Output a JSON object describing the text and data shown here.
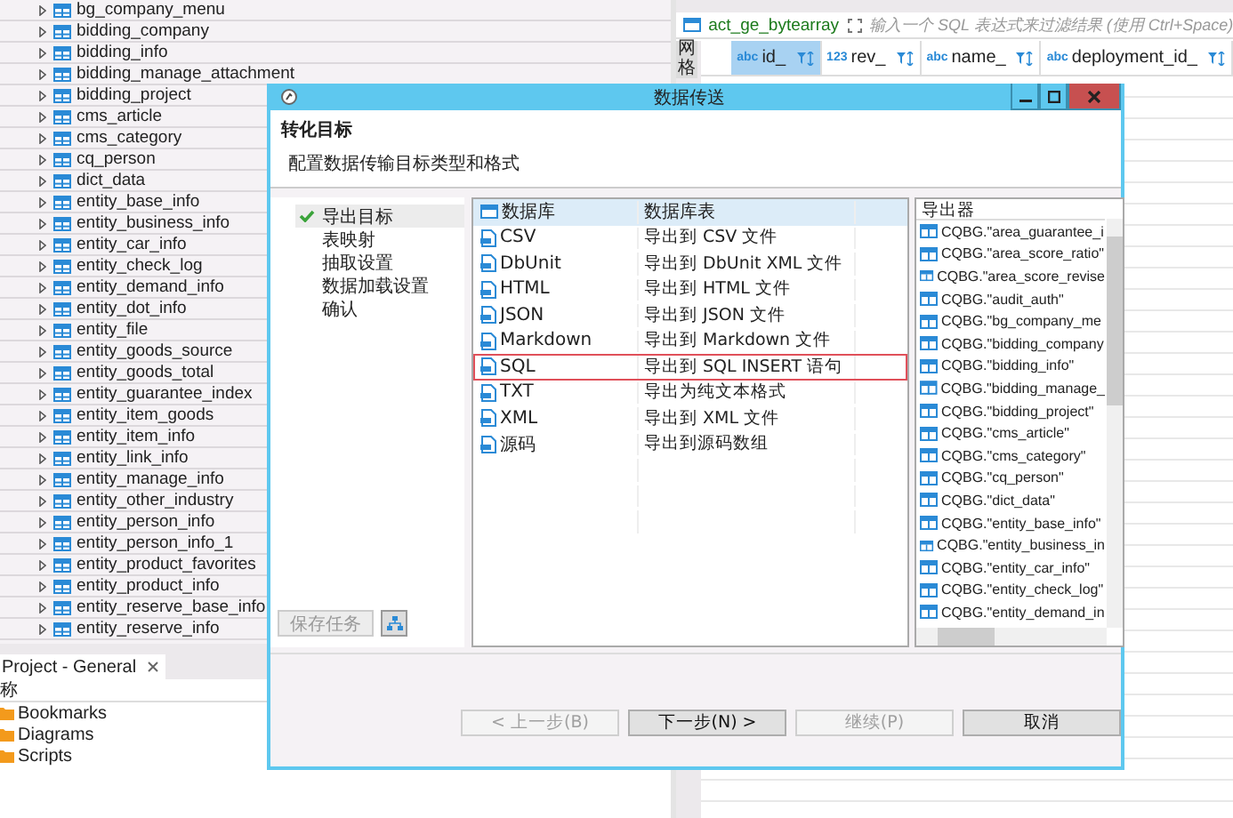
{
  "navigator": {
    "tables": [
      "bg_company_menu",
      "bidding_company",
      "bidding_info",
      "bidding_manage_attachment",
      "bidding_project",
      "cms_article",
      "cms_category",
      "cq_person",
      "dict_data",
      "entity_base_info",
      "entity_business_info",
      "entity_car_info",
      "entity_check_log",
      "entity_demand_info",
      "entity_dot_info",
      "entity_file",
      "entity_goods_source",
      "entity_goods_total",
      "entity_guarantee_index",
      "entity_item_goods",
      "entity_item_info",
      "entity_link_info",
      "entity_manage_info",
      "entity_other_industry",
      "entity_person_info",
      "entity_person_info_1",
      "entity_product_favorites",
      "entity_product_info",
      "entity_reserve_base_info",
      "entity_reserve_info"
    ]
  },
  "project_panel": {
    "tab": "Project - General",
    "column_1": "称",
    "items": [
      "Bookmarks",
      "Diagrams",
      "Scripts"
    ]
  },
  "editor": {
    "table_name": "act_ge_bytearray",
    "filter": {
      "placeholder": "输入一个 SQL 表达式来过滤结果 (使用 Ctrl+Space)"
    },
    "side_tab": "网格",
    "columns": [
      {
        "type": "abc",
        "label": "id_",
        "selected": true
      },
      {
        "type": "123",
        "label": "rev_",
        "selected": false
      },
      {
        "type": "abc",
        "label": "name_",
        "selected": false
      },
      {
        "type": "abc",
        "label": "deployment_id_",
        "selected": false
      }
    ]
  },
  "dialog": {
    "title": "数据传送",
    "heading": "转化目标",
    "description": "配置数据传输目标类型和格式",
    "steps": [
      {
        "label": "导出目标",
        "done": true,
        "selected": true
      },
      {
        "label": "表映射",
        "done": false,
        "selected": false
      },
      {
        "label": "抽取设置",
        "done": false,
        "selected": false
      },
      {
        "label": "数据加载设置",
        "done": false,
        "selected": false
      },
      {
        "label": "确认",
        "done": false,
        "selected": false
      }
    ],
    "save_task": "保存任务",
    "formats_header": {
      "column_1": "数据库",
      "column_2": "数据库表"
    },
    "formats": [
      {
        "name": "CSV",
        "description": "导出到 CSV 文件",
        "selected": false
      },
      {
        "name": "DbUnit",
        "description": "导出到 DbUnit XML 文件",
        "selected": false
      },
      {
        "name": "HTML",
        "description": "导出到 HTML 文件",
        "selected": false
      },
      {
        "name": "JSON",
        "description": "导出到 JSON 文件",
        "selected": false
      },
      {
        "name": "Markdown",
        "description": "导出到 Markdown 文件",
        "selected": false
      },
      {
        "name": "SQL",
        "description": "导出到 SQL INSERT 语句",
        "selected": true
      },
      {
        "name": "TXT",
        "description": "导出为纯文本格式",
        "selected": false
      },
      {
        "name": "XML",
        "description": "导出到 XML 文件",
        "selected": false
      },
      {
        "name": "源码",
        "description": "导出到源码数组",
        "selected": false
      }
    ],
    "exporter_header": "导出器",
    "exporters": [
      "CQBG.\"area_guarantee_i",
      "CQBG.\"area_score_ratio\"",
      "CQBG.\"area_score_revise",
      "CQBG.\"audit_auth\"",
      "CQBG.\"bg_company_me",
      "CQBG.\"bidding_company",
      "CQBG.\"bidding_info\"",
      "CQBG.\"bidding_manage_",
      "CQBG.\"bidding_project\"",
      "CQBG.\"cms_article\"",
      "CQBG.\"cms_category\"",
      "CQBG.\"cq_person\"",
      "CQBG.\"dict_data\"",
      "CQBG.\"entity_base_info\"",
      "CQBG.\"entity_business_in",
      "CQBG.\"entity_car_info\"",
      "CQBG.\"entity_check_log\"",
      "CQBG.\"entity_demand_in"
    ],
    "buttons": [
      {
        "label": "< 上一步(B)",
        "disabled": true
      },
      {
        "label": "下一步(N) >",
        "disabled": false
      },
      {
        "label": "继续(P)",
        "disabled": true
      },
      {
        "label": "取消",
        "disabled": false
      }
    ]
  }
}
